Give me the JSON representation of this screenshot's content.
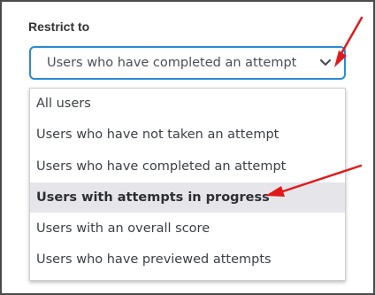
{
  "restrict": {
    "label": "Restrict to",
    "selected_value": "Users who have completed an attempt",
    "options": [
      {
        "label": "All users"
      },
      {
        "label": "Users who have not taken an attempt"
      },
      {
        "label": "Users who have completed an attempt"
      },
      {
        "label": "Users with attempts in progress",
        "highlighted": true
      },
      {
        "label": "Users with an overall score"
      },
      {
        "label": "Users who have previewed attempts"
      }
    ]
  },
  "colors": {
    "focus_border": "#2a8ad4",
    "highlight_bg": "#e6e6ea",
    "annotation_arrow": "#e01a1a"
  },
  "icons": {
    "select_chevron": "chevron-down-icon",
    "annotations": [
      "annotation-arrow-icon",
      "annotation-arrow-icon"
    ]
  }
}
